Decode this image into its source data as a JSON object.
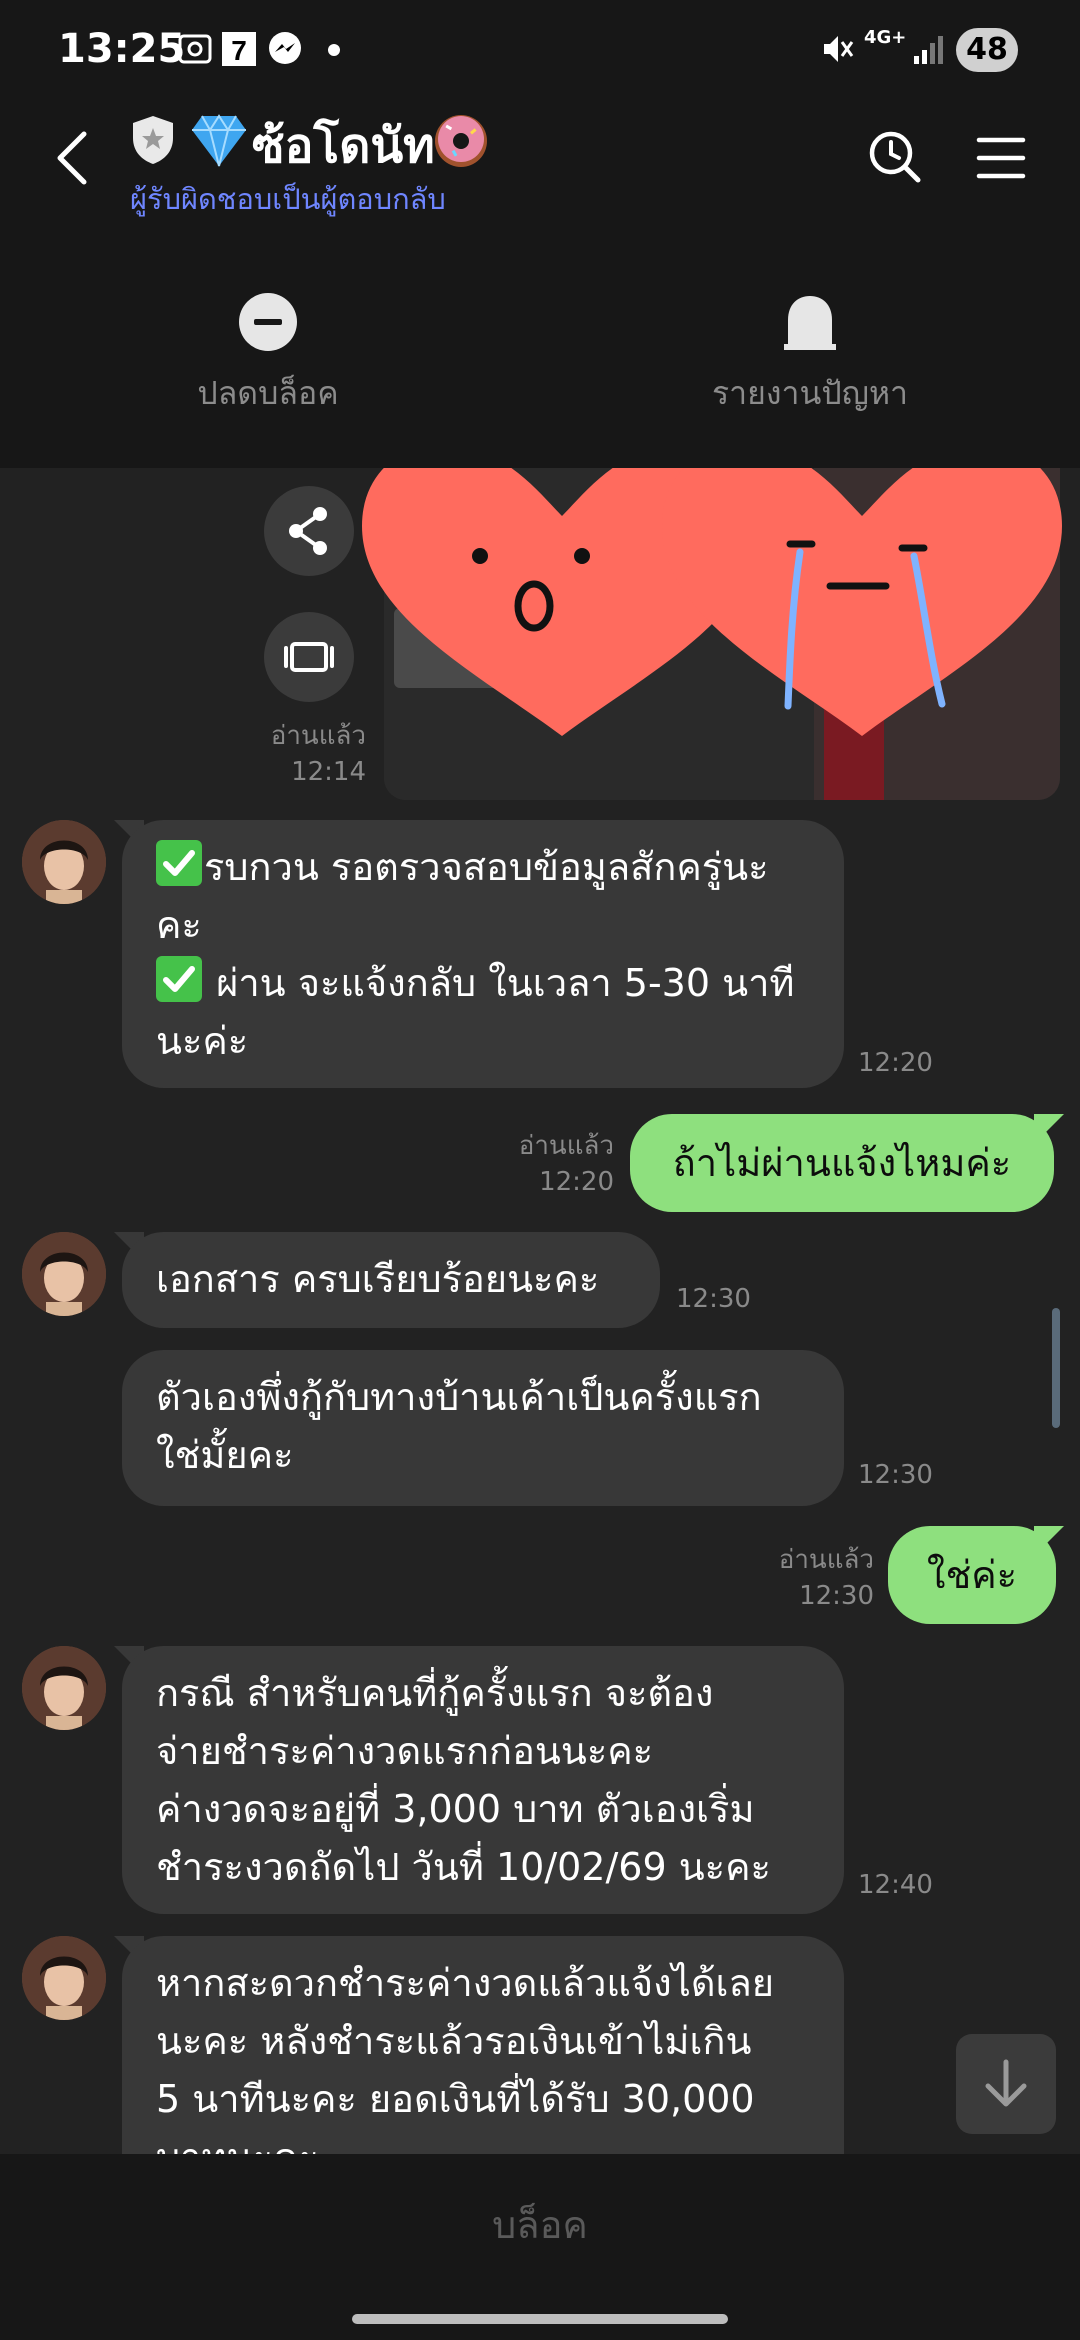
{
  "status_bar": {
    "time": "13:25",
    "network": "4G+",
    "battery": "48",
    "icons": [
      "screenshot-icon",
      "seven-eleven-icon",
      "messenger-icon",
      "mute-icon",
      "signal-icon"
    ]
  },
  "header": {
    "title": "ซ้อโดนัท",
    "subtitle": "ผู้รับผิดชอบเป็นผู้ตอบกลับ",
    "icons": [
      "back-icon",
      "shield-icon",
      "gem-icon",
      "donut-icon",
      "history-search-icon",
      "menu-icon"
    ]
  },
  "actions": {
    "unblock_label": "ปลดบล็อค",
    "report_label": "รายงานปัญหา"
  },
  "chat": {
    "photo_meta": {
      "read": "อ่านแล้ว",
      "time": "12:14"
    },
    "messages": [
      {
        "direction": "in",
        "lines": [
          "รบกวน รอตรวจสอบข้อมูลสักครู่นะ",
          "คะ",
          " ผ่าน จะแจ้งกลับ ในเวลา 5-30 นาที",
          "นะค่ะ"
        ],
        "time": "12:20"
      },
      {
        "direction": "out",
        "text": "ถ้าไม่ผ่านแจ้งไหมค่ะ",
        "read": "อ่านแล้ว",
        "time": "12:20"
      },
      {
        "direction": "in",
        "lines": [
          "เอกสาร ครบเรียบร้อยนะคะ"
        ],
        "time": "12:30"
      },
      {
        "direction": "in",
        "lines": [
          "ตัวเองพึ่งกู้กับทางบ้านเค้าเป็นครั้งแรก",
          "ใช่มั้ยคะ"
        ],
        "time": "12:30"
      },
      {
        "direction": "out",
        "text": "ใช่ค่ะ",
        "read": "อ่านแล้ว",
        "time": "12:30"
      },
      {
        "direction": "in",
        "lines": [
          "กรณี สำหรับคนที่กู้ครั้งแรก จะต้อง",
          "จ่ายชำระค่างวดแรกก่อนนะคะ",
          "ค่างวดจะอยู่ที่ 3,000 บาท ตัวเองเริ่ม",
          "ชำระงวดถัดไป วันที่ 10/02/69 นะคะ"
        ],
        "time": "12:40"
      },
      {
        "direction": "in",
        "lines": [
          "หากสะดวกชำระค่างวดแล้วแจ้งได้เลย",
          "นะคะ หลังชำระแล้วรอเงินเข้าไม่เกิน",
          "5 นาทีนะคะ ยอดเงินที่ได้รับ 30,000",
          "บาทนะคะ"
        ],
        "time": ""
      }
    ]
  },
  "bottom": {
    "block_label": "บล็อค"
  },
  "colors": {
    "background": "#171717",
    "chat_background": "#222222",
    "incoming_bubble": "#383838",
    "outgoing_bubble": "#8ee07e",
    "subtitle": "#6f86ff",
    "sticker": "#ff6b5e"
  }
}
